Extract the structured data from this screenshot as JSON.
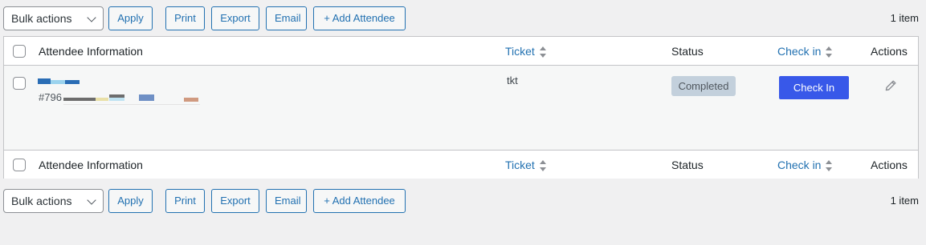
{
  "toolbar": {
    "bulk_actions": "Bulk actions",
    "apply": "Apply",
    "print": "Print",
    "export": "Export",
    "email": "Email",
    "add_attendee": "+ Add Attendee",
    "item_count": "1 item"
  },
  "table": {
    "columns": {
      "attendee_information": "Attendee Information",
      "ticket": "Ticket",
      "status": "Status",
      "check_in": "Check in",
      "actions": "Actions"
    },
    "rows": [
      {
        "attendee_id": "#796",
        "ticket": "tkt",
        "status": "Completed",
        "check_in_label": "Check In",
        "action_icon": "pencil-icon"
      }
    ]
  },
  "colors": {
    "link": "#2271b1",
    "primary_button": "#3858e9",
    "badge_bg": "#c3d0dc"
  }
}
